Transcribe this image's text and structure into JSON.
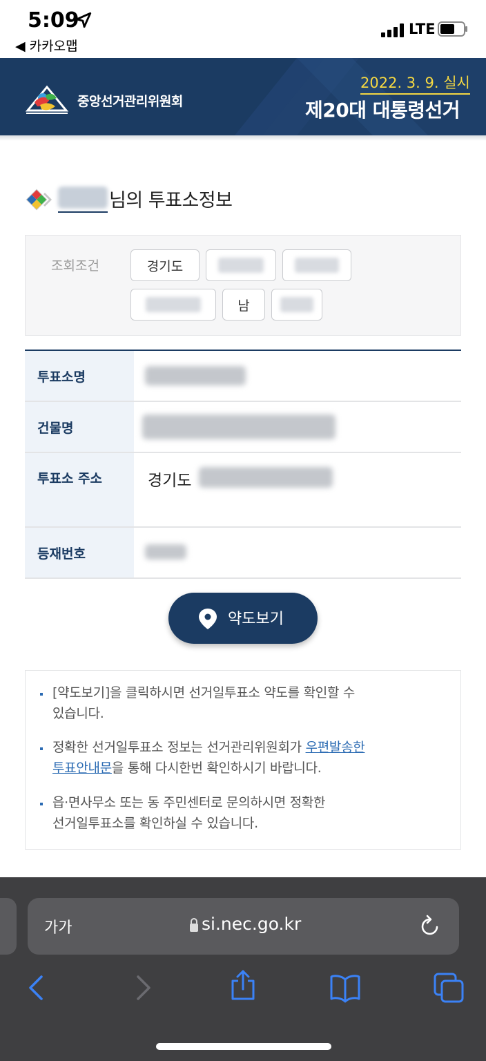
{
  "status_bar": {
    "time": "5:09",
    "back_app": "◀ 카카오맵",
    "network": "LTE"
  },
  "header": {
    "org_name": "중앙선거관리위원회",
    "election_date": "2022. 3. 9. 실시",
    "election_title": "제20대 대통령선거"
  },
  "page": {
    "title_suffix": "님의 투표소정보"
  },
  "query": {
    "label": "조회조건",
    "chips": [
      "경기도",
      "",
      "",
      "",
      "남",
      ""
    ]
  },
  "table": {
    "rows": [
      {
        "header": "투표소명",
        "value": ""
      },
      {
        "header": "건물명",
        "value": ""
      },
      {
        "header": "투표소 주소",
        "value": "경기도"
      },
      {
        "header": "등재번호",
        "value": ""
      }
    ]
  },
  "map_button": {
    "label": "약도보기"
  },
  "notices": {
    "n1_line1": "[약도보기]을 클릭하시면 선거일투표소 약도를 확인할 수",
    "n1_line2": "있습니다.",
    "n2_line1_pre": "정확한 선거일투표소 정보는 선거관리위원회가 ",
    "n2_link1": "우편발송한",
    "n2_link2": "투표안내문",
    "n2_line2_post": "을 통해 다시한번 확인하시기 바랍니다.",
    "n3_line1": "읍·면사무소 또는 동 주민센터로 문의하시면 정확한",
    "n3_line2": "선거일투표소를 확인하실 수 있습니다."
  },
  "browser": {
    "text_size": "가가",
    "url": "si.nec.go.kr"
  },
  "colors": {
    "brand_navy": "#1b3b62",
    "date_yellow": "#f5d842",
    "link_blue": "#2b6bb3",
    "ios_blue": "#3b82f6"
  }
}
